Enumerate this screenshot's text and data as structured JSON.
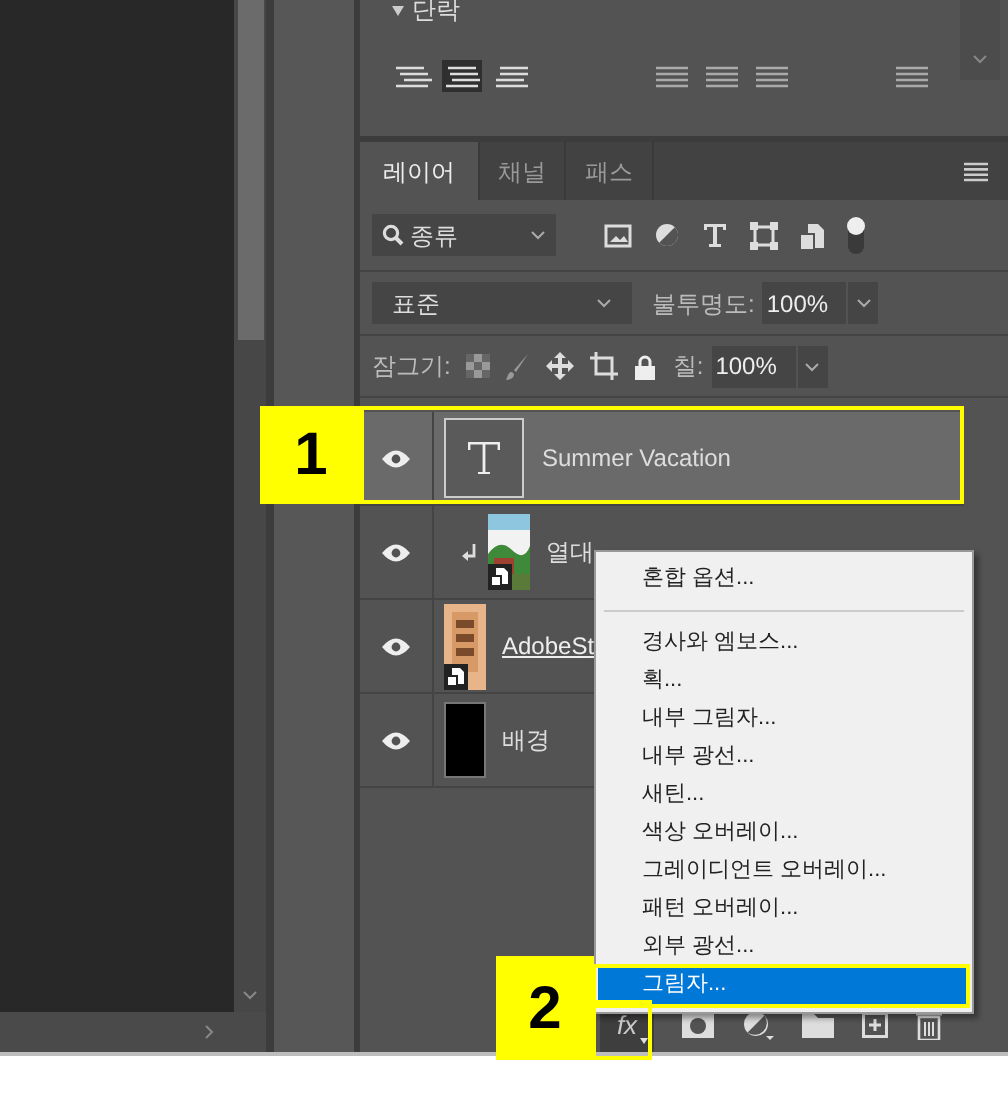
{
  "paragraph_panel": {
    "title": "단락",
    "align_buttons": [
      {
        "selected": false
      },
      {
        "selected": true
      },
      {
        "selected": false
      }
    ]
  },
  "tabs": [
    {
      "label": "레이어",
      "selected": true
    },
    {
      "label": "채널",
      "selected": false
    },
    {
      "label": "패스",
      "selected": false
    }
  ],
  "filter": {
    "value": "종류"
  },
  "blend_mode": "표준",
  "opacity_label": "불투명도:",
  "opacity": "100%",
  "lock_label": "잠그기:",
  "fill_label": "칠:",
  "fill": "100%",
  "layers": [
    {
      "name": "Summer Vacation",
      "kind": "text",
      "selected": true,
      "visible": true,
      "clipped": false
    },
    {
      "name": "열대",
      "kind": "smart",
      "selected": false,
      "visible": true,
      "clipped": true
    },
    {
      "name": "AdobeSt",
      "kind": "smart",
      "selected": false,
      "visible": true,
      "clipped": false
    },
    {
      "name": "배경",
      "kind": "fill",
      "selected": false,
      "visible": true,
      "clipped": false
    }
  ],
  "fx_button": {
    "label": "fx"
  },
  "context_menu": [
    {
      "label": "혼합 옵션...",
      "selected": false
    },
    {
      "label": "경사와 엠보스...",
      "selected": false
    },
    {
      "label": "획...",
      "selected": false
    },
    {
      "label": "내부 그림자...",
      "selected": false
    },
    {
      "label": "내부 광선...",
      "selected": false
    },
    {
      "label": "새틴...",
      "selected": false
    },
    {
      "label": "색상 오버레이...",
      "selected": false
    },
    {
      "label": "그레이디언트 오버레이...",
      "selected": false
    },
    {
      "label": "패턴 오버레이...",
      "selected": false
    },
    {
      "label": "외부 광선...",
      "selected": false
    },
    {
      "label": "그림자...",
      "selected": true
    }
  ],
  "callouts": [
    {
      "label": "1"
    },
    {
      "label": "2"
    }
  ]
}
